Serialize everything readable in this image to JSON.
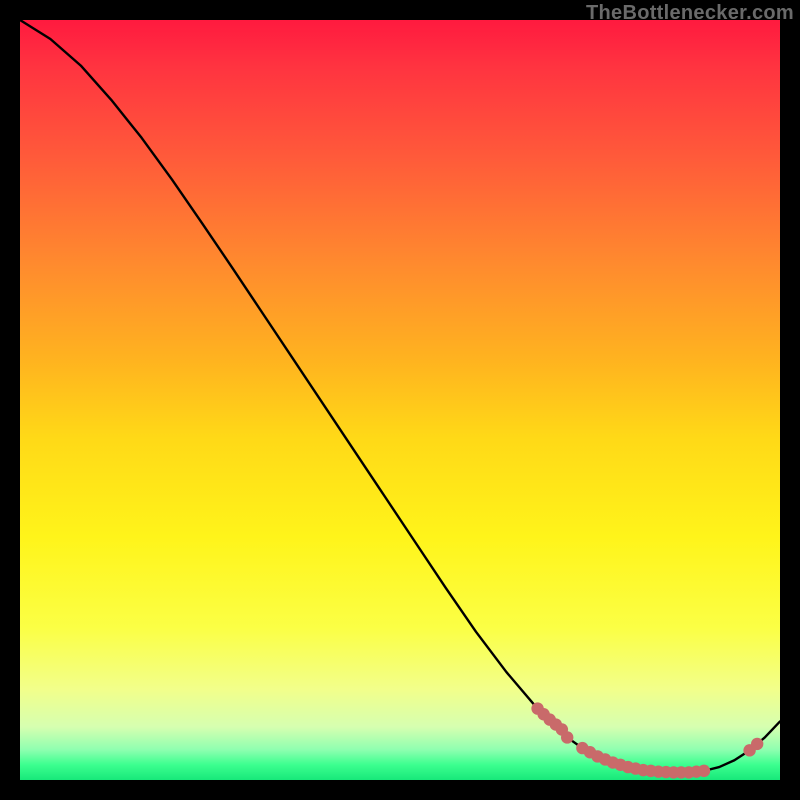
{
  "watermark": "TheBottlenecker.com",
  "colors": {
    "frame": "#000000",
    "curve_stroke": "#000000",
    "marker_fill": "#c96a6a",
    "marker_stroke": "#c96a6a"
  },
  "chart_data": {
    "type": "line",
    "title": "",
    "xlabel": "",
    "ylabel": "",
    "xlim": [
      0,
      100
    ],
    "ylim": [
      0,
      100
    ],
    "grid": false,
    "legend": false,
    "series": [
      {
        "name": "bottleneck-curve",
        "x": [
          0,
          4,
          8,
          12,
          16,
          20,
          24,
          28,
          32,
          36,
          40,
          44,
          48,
          52,
          56,
          60,
          64,
          68,
          72,
          74,
          76,
          78,
          80,
          82,
          84,
          86,
          88,
          90,
          92,
          94,
          96,
          98,
          100
        ],
        "y": [
          100,
          97.5,
          94,
          89.5,
          84.5,
          79,
          73.2,
          67.3,
          61.3,
          55.3,
          49.3,
          43.3,
          37.3,
          31.3,
          25.3,
          19.5,
          14.2,
          9.5,
          5.6,
          4.2,
          3.1,
          2.3,
          1.7,
          1.3,
          1.1,
          1.0,
          1.0,
          1.2,
          1.7,
          2.6,
          3.9,
          5.6,
          7.7
        ]
      }
    ],
    "markers": [
      {
        "x": 68.1,
        "y": 9.4
      },
      {
        "x": 68.9,
        "y": 8.65
      },
      {
        "x": 69.7,
        "y": 7.95
      },
      {
        "x": 70.5,
        "y": 7.3
      },
      {
        "x": 71.3,
        "y": 6.65
      },
      {
        "x": 72.0,
        "y": 5.6
      },
      {
        "x": 74.0,
        "y": 4.2
      },
      {
        "x": 75.0,
        "y": 3.65
      },
      {
        "x": 76.0,
        "y": 3.1
      },
      {
        "x": 77.0,
        "y": 2.7
      },
      {
        "x": 78.0,
        "y": 2.3
      },
      {
        "x": 79.0,
        "y": 2.0
      },
      {
        "x": 80.0,
        "y": 1.7
      },
      {
        "x": 81.0,
        "y": 1.5
      },
      {
        "x": 82.0,
        "y": 1.3
      },
      {
        "x": 83.0,
        "y": 1.2
      },
      {
        "x": 84.0,
        "y": 1.1
      },
      {
        "x": 85.0,
        "y": 1.05
      },
      {
        "x": 86.0,
        "y": 1.0
      },
      {
        "x": 87.0,
        "y": 1.0
      },
      {
        "x": 88.0,
        "y": 1.0
      },
      {
        "x": 89.0,
        "y": 1.1
      },
      {
        "x": 90.0,
        "y": 1.2
      },
      {
        "x": 96.0,
        "y": 3.9
      },
      {
        "x": 97.0,
        "y": 4.75
      }
    ]
  }
}
